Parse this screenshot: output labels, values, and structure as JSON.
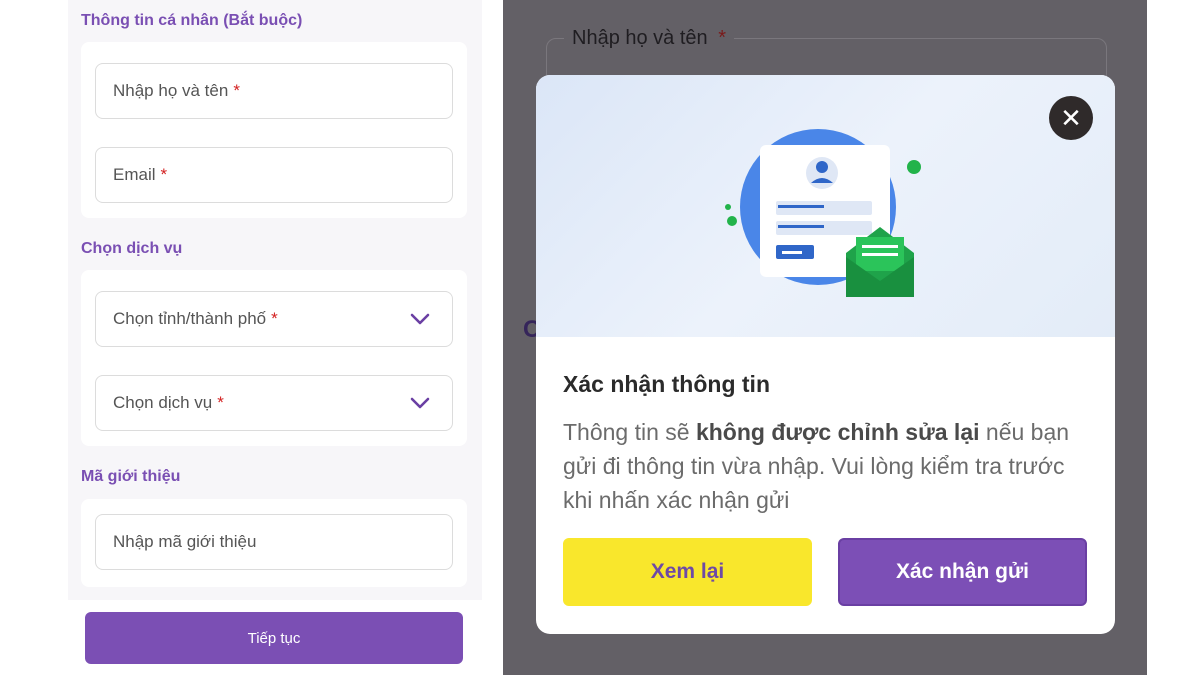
{
  "form": {
    "section_personal": "Thông tin cá nhân (Bắt buộc)",
    "name_placeholder": "Nhập họ và tên",
    "email_placeholder": "Email",
    "section_service": "Chọn dịch vụ",
    "province_placeholder": "Chọn tỉnh/thành phố",
    "service_placeholder": "Chọn dịch vụ",
    "section_referral": "Mã giới thiệu",
    "referral_placeholder": "Nhập mã giới thiệu",
    "required_mark": "*",
    "continue_label": "Tiếp tục"
  },
  "background": {
    "name_label": "Nhập họ và tên",
    "required_mark": "*",
    "partial_letter": "C"
  },
  "modal": {
    "close_symbol": "✕",
    "title": "Xác nhận thông tin",
    "body_prefix": "Thông tin sẽ ",
    "body_bold": "không được chỉnh sửa lại",
    "body_suffix": " nếu bạn gửi đi thông tin vừa nhập. Vui lòng kiểm tra trước khi nhấn xác nhận gửi",
    "review_label": "Xem lại",
    "confirm_label": "Xác nhận gửi"
  },
  "colors": {
    "brand_purple": "#7b4fb4",
    "review_yellow": "#f9e72c",
    "required_red": "#d32020",
    "envelope_green": "#1fa34a"
  }
}
